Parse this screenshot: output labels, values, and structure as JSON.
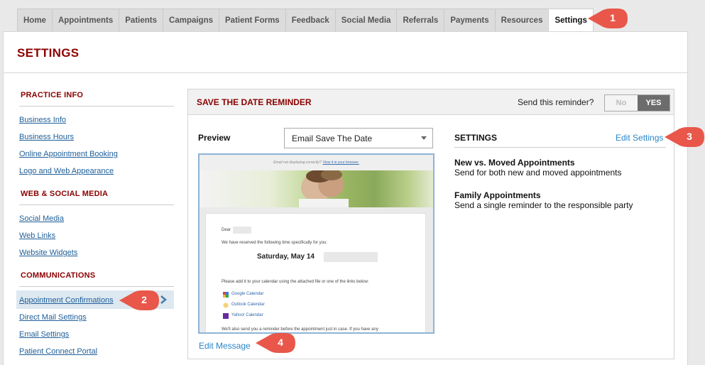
{
  "tabs": [
    "Home",
    "Appointments",
    "Patients",
    "Campaigns",
    "Patient Forms",
    "Feedback",
    "Social Media",
    "Referrals",
    "Payments",
    "Resources",
    "Settings"
  ],
  "active_tab": "Settings",
  "page_title": "SETTINGS",
  "sidebar": {
    "sections": [
      {
        "heading": "PRACTICE INFO",
        "links": [
          "Business Info",
          "Business Hours",
          "Online Appointment Booking",
          "Logo and Web Appearance"
        ]
      },
      {
        "heading": "WEB & SOCIAL MEDIA",
        "links": [
          "Social Media",
          "Web Links",
          "Website Widgets"
        ]
      },
      {
        "heading": "COMMUNICATIONS",
        "links": [
          "Appointment Confirmations",
          "Direct Mail Settings",
          "Email Settings",
          "Patient Connect Portal"
        ]
      }
    ],
    "active_link": "Appointment Confirmations"
  },
  "card": {
    "title": "SAVE THE DATE REMINDER",
    "send_label": "Send this reminder?",
    "toggle_no": "No",
    "toggle_yes": "YES",
    "toggle_value": "YES"
  },
  "preview": {
    "label": "Preview",
    "template_select": "Email Save The Date",
    "edit_message": "Edit Message",
    "email": {
      "top_line": "Email not displaying correctly?",
      "top_link": "View it in your browser.",
      "greeting": "Dear",
      "intro": "We have reserved the following time specifically for you:",
      "date": "Saturday, May 14",
      "calendar_intro": "Please add it to your calendar using the attached file or one of the links below:",
      "calendars": [
        "Google Calendar",
        "Outlook Calendar",
        "Yahoo! Calendar"
      ],
      "footer": "We'll also send you a reminder before the appointment just in case. If you have any"
    }
  },
  "settings": {
    "heading": "SETTINGS",
    "edit_link": "Edit Settings",
    "options": [
      {
        "title": "New vs. Moved Appointments",
        "desc": "Send for both new and moved appointments"
      },
      {
        "title": "Family Appointments",
        "desc": "Send a single reminder to the responsible party"
      }
    ]
  },
  "callouts": [
    "1",
    "2",
    "3",
    "4"
  ],
  "colors": {
    "accent_red": "#8b0000",
    "link_blue": "#2a86c8",
    "callout": "#e8574a"
  }
}
